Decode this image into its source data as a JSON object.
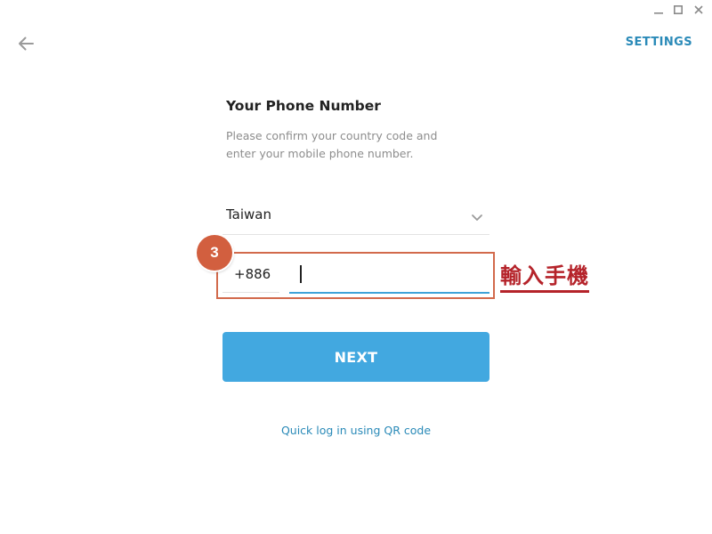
{
  "window_controls": {
    "minimize_icon": "minimize-icon",
    "maximize_icon": "maximize-icon",
    "close_icon": "close-icon"
  },
  "header": {
    "back_icon": "arrow-left-icon",
    "settings_label": "SETTINGS"
  },
  "form": {
    "title": "Your Phone Number",
    "subtitle": "Please confirm your country code and enter your mobile phone number.",
    "country": {
      "selected": "Taiwan",
      "icon": "chevron-down-icon"
    },
    "country_code": "+886",
    "phone_value": "",
    "next_label": "NEXT",
    "qr_link_label": "Quick log in using QR code"
  },
  "tutorial_overlay": {
    "step_number": "3",
    "annotation_text": "輸入手機",
    "highlight_color": "#d26a4c",
    "annotation_color": "#b5232a"
  },
  "colors": {
    "accent": "#42a8e0",
    "link": "#2a8ab8",
    "subtitle": "#8d8d8d"
  }
}
